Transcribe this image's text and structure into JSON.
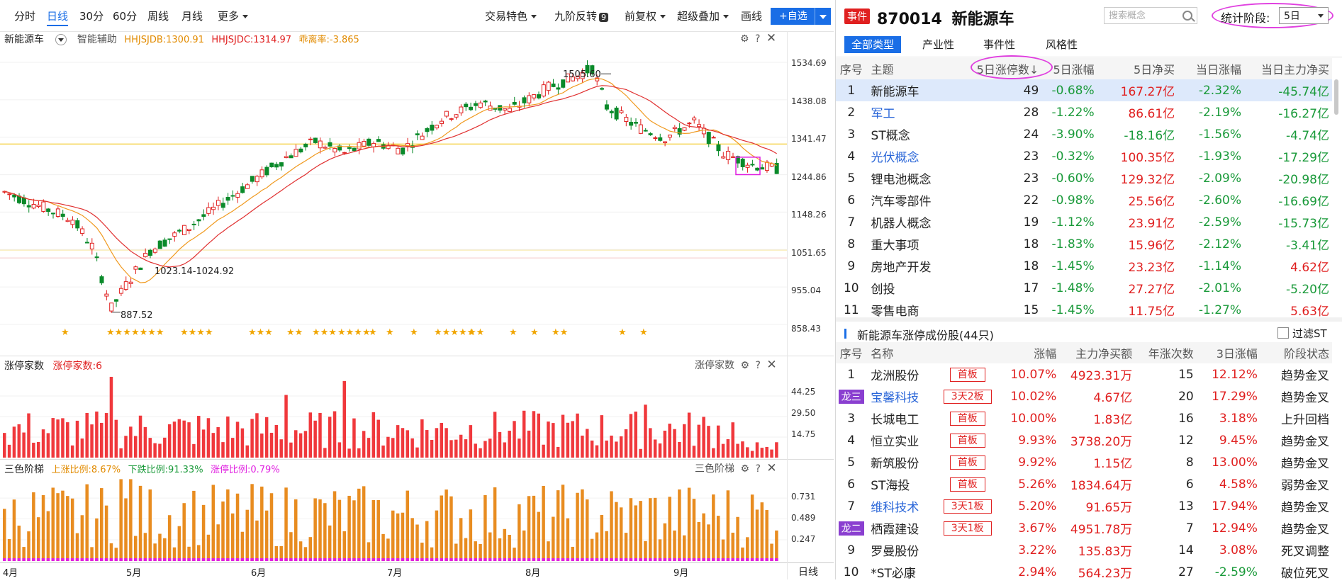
{
  "toolbar": {
    "tabs": [
      "分时",
      "日线",
      "30分",
      "60分",
      "周线",
      "月线"
    ],
    "more": "更多",
    "right_items": [
      "交易特色",
      "九阶反转",
      "前复权",
      "超级叠加",
      "画线"
    ],
    "nine_badge": "9",
    "add_button": "+自选"
  },
  "main_chart": {
    "name": "新能源车",
    "aux": "智能辅助",
    "ind1": "HHJSJDB:1300.91",
    "ind2": "HHJSJDC:1314.97",
    "ind3": "乖离率:-3.865",
    "y_labels": [
      "1534.69",
      "1438.08",
      "1341.47",
      "1244.86",
      "1148.26",
      "1051.65",
      "955.04",
      "858.43"
    ],
    "annotations": {
      "high": "1505.60",
      "range": "1023.14-1024.92",
      "low": "887.52"
    },
    "stars": [
      "★",
      "★★★★★★★",
      "★★★★",
      "★★★",
      "★★",
      "★★★",
      "★★★★",
      "★",
      "★",
      "★",
      "★★★★★",
      "★★",
      "★",
      "★",
      "★★",
      "★",
      "★"
    ]
  },
  "zt_panel": {
    "title": "涨停家数",
    "label": "涨停家数:6",
    "panel_name": "涨停家数",
    "y_labels": [
      "44.25",
      "29.50",
      "14.75"
    ]
  },
  "ladder_panel": {
    "title": "三色阶梯",
    "up": "上涨比例:8.67%",
    "down": "下跌比例:91.33%",
    "limit": "涨停比例:0.79%",
    "panel_name": "三色阶梯",
    "y_labels": [
      "0.731",
      "0.489",
      "0.247"
    ]
  },
  "x_labels": [
    "4月",
    "5月",
    "6月",
    "7月",
    "8月",
    "9月"
  ],
  "period": "日线",
  "chart_data": {
    "type": "candlestick",
    "ylim": [
      858.43,
      1534.69
    ],
    "annotated": {
      "high": 1505.6,
      "low": 887.52,
      "gap": [
        1023.14,
        1024.92
      ]
    },
    "zt_ylim": [
      0,
      59
    ],
    "ladder_ylim": [
      0,
      0.97
    ]
  },
  "right": {
    "event_tag": "事件",
    "code": "870014",
    "name": "新能源车",
    "search_placeholder": "搜索概念",
    "stat_label": "统计阶段:",
    "stat_value": "5日",
    "tabs": [
      "全部类型",
      "产业性",
      "事件性",
      "风格性"
    ],
    "theme_headers": [
      "序号",
      "主题",
      "5日涨停数↓",
      "5日涨幅",
      "5日净买",
      "当日涨幅",
      "当日主力净买"
    ],
    "themes": [
      {
        "no": "1",
        "name": "新能源车",
        "zt": "49",
        "chg5": "-0.68%",
        "buy5": "167.27亿",
        "chg": "-2.32%",
        "main": "-45.74亿",
        "link": false
      },
      {
        "no": "2",
        "name": "军工",
        "zt": "28",
        "chg5": "-1.22%",
        "buy5": "86.61亿",
        "chg": "-2.19%",
        "main": "-16.27亿",
        "link": true
      },
      {
        "no": "3",
        "name": "ST概念",
        "zt": "24",
        "chg5": "-3.90%",
        "buy5": "-18.16亿",
        "chg": "-1.56%",
        "main": "-4.74亿",
        "link": false
      },
      {
        "no": "4",
        "name": "光伏概念",
        "zt": "23",
        "chg5": "-0.32%",
        "buy5": "100.35亿",
        "chg": "-1.93%",
        "main": "-17.29亿",
        "link": true
      },
      {
        "no": "5",
        "name": "锂电池概念",
        "zt": "23",
        "chg5": "-0.60%",
        "buy5": "129.32亿",
        "chg": "-2.09%",
        "main": "-20.98亿",
        "link": false
      },
      {
        "no": "6",
        "name": "汽车零部件",
        "zt": "22",
        "chg5": "-0.98%",
        "buy5": "25.56亿",
        "chg": "-2.60%",
        "main": "-16.69亿",
        "link": false
      },
      {
        "no": "7",
        "name": "机器人概念",
        "zt": "19",
        "chg5": "-1.12%",
        "buy5": "23.91亿",
        "chg": "-2.59%",
        "main": "-15.73亿",
        "link": false
      },
      {
        "no": "8",
        "name": "重大事项",
        "zt": "18",
        "chg5": "-1.83%",
        "buy5": "15.96亿",
        "chg": "-2.12%",
        "main": "-3.41亿",
        "link": false
      },
      {
        "no": "9",
        "name": "房地产开发",
        "zt": "18",
        "chg5": "-1.45%",
        "buy5": "23.23亿",
        "chg": "-1.14%",
        "main": "4.62亿",
        "link": false
      },
      {
        "no": "10",
        "name": "创投",
        "zt": "17",
        "chg5": "-1.48%",
        "buy5": "27.27亿",
        "chg": "-2.01%",
        "main": "-5.20亿",
        "link": false
      },
      {
        "no": "11",
        "name": "零售电商",
        "zt": "15",
        "chg5": "-1.45%",
        "buy5": "11.75亿",
        "chg": "-1.27%",
        "main": "5.63亿",
        "link": false
      }
    ],
    "stock_section": "新能源车涨停成份股(44只)",
    "filter_st": "过滤ST",
    "stock_headers": [
      "序号",
      "名称",
      "",
      "涨幅",
      "主力净买额",
      "年涨次数",
      "3日涨幅",
      "阶段状态"
    ],
    "stocks": [
      {
        "no": "1",
        "name": "龙洲股份",
        "board": "首板",
        "chg": "10.07%",
        "main": "4923.31万",
        "cnt": "15",
        "chg3": "12.12%",
        "state": "趋势金叉",
        "link": false
      },
      {
        "no": "龙三",
        "name": "宝馨科技",
        "board": "3天2板",
        "chg": "10.02%",
        "main": "4.67亿",
        "cnt": "20",
        "chg3": "17.29%",
        "state": "趋势金叉",
        "link": true
      },
      {
        "no": "3",
        "name": "长城电工",
        "board": "首板",
        "chg": "10.00%",
        "main": "1.83亿",
        "cnt": "16",
        "chg3": "3.18%",
        "state": "上升回档",
        "link": false
      },
      {
        "no": "4",
        "name": "恒立实业",
        "board": "首板",
        "chg": "9.93%",
        "main": "3738.20万",
        "cnt": "12",
        "chg3": "9.45%",
        "state": "趋势金叉",
        "link": false
      },
      {
        "no": "5",
        "name": "新筑股份",
        "board": "首板",
        "chg": "9.92%",
        "main": "1.15亿",
        "cnt": "8",
        "chg3": "13.00%",
        "state": "趋势金叉",
        "link": false
      },
      {
        "no": "6",
        "name": "ST海投",
        "board": "首板",
        "chg": "5.26%",
        "main": "1834.64万",
        "cnt": "6",
        "chg3": "4.58%",
        "state": "弱势金叉",
        "link": false
      },
      {
        "no": "7",
        "name": "维科技术",
        "board": "3天1板",
        "chg": "5.20%",
        "main": "91.65万",
        "cnt": "13",
        "chg3": "17.94%",
        "state": "趋势金叉",
        "link": true
      },
      {
        "no": "龙二",
        "name": "栖霞建设",
        "board": "3天1板",
        "chg": "3.67%",
        "main": "4951.78万",
        "cnt": "7",
        "chg3": "12.94%",
        "state": "趋势金叉",
        "link": false
      },
      {
        "no": "9",
        "name": "罗曼股份",
        "board": "",
        "chg": "3.22%",
        "main": "135.83万",
        "cnt": "14",
        "chg3": "3.08%",
        "state": "死叉调整",
        "link": false
      },
      {
        "no": "10",
        "name": "*ST必康",
        "board": "",
        "chg": "2.94%",
        "main": "564.23万",
        "cnt": "27",
        "chg3": "-2.59%",
        "state": "破位死叉",
        "link": false
      }
    ]
  }
}
